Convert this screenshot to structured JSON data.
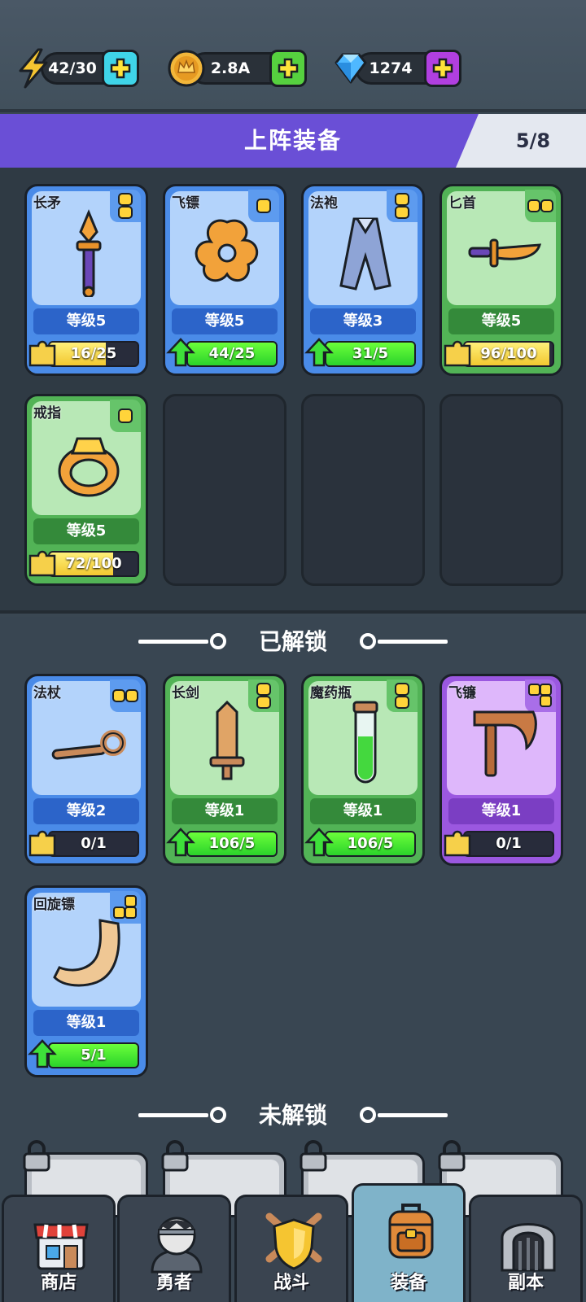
{
  "resources": {
    "energy": {
      "value": "42/30",
      "icon": "lightning-icon"
    },
    "gold": {
      "value": "2.8A",
      "icon": "crown-coin-icon"
    },
    "gems": {
      "value": "1274",
      "icon": "diamond-icon"
    }
  },
  "banner": {
    "title": "上阵装备",
    "count": "5/8"
  },
  "equipped": [
    {
      "name": "长矛",
      "level": "等级5",
      "progress": "16/25",
      "fill": 0.64,
      "color": "blue",
      "ready": false,
      "icon": "spear-icon"
    },
    {
      "name": "飞镖",
      "level": "等级5",
      "progress": "44/25",
      "fill": 1.0,
      "color": "blue",
      "ready": true,
      "icon": "shuriken-icon"
    },
    {
      "name": "法袍",
      "level": "等级3",
      "progress": "31/5",
      "fill": 1.0,
      "color": "blue",
      "ready": true,
      "icon": "robe-icon"
    },
    {
      "name": "匕首",
      "level": "等级5",
      "progress": "96/100",
      "fill": 0.96,
      "color": "green",
      "ready": false,
      "icon": "dagger-icon"
    },
    {
      "name": "戒指",
      "level": "等级5",
      "progress": "72/100",
      "fill": 0.72,
      "color": "green",
      "ready": false,
      "icon": "ring-icon"
    }
  ],
  "unlocked_title": "已解锁",
  "unlocked": [
    {
      "name": "法杖",
      "level": "等级2",
      "progress": "0/1",
      "fill": 0.0,
      "color": "blue",
      "ready": false,
      "icon": "staff-icon"
    },
    {
      "name": "长剑",
      "level": "等级1",
      "progress": "106/5",
      "fill": 1.0,
      "color": "green",
      "ready": true,
      "icon": "sword-icon"
    },
    {
      "name": "魔药瓶",
      "level": "等级1",
      "progress": "106/5",
      "fill": 1.0,
      "color": "green",
      "ready": true,
      "icon": "potion-icon"
    },
    {
      "name": "飞镰",
      "level": "等级1",
      "progress": "0/1",
      "fill": 0.0,
      "color": "purple",
      "ready": false,
      "icon": "sickle-icon"
    },
    {
      "name": "回旋镖",
      "level": "等级1",
      "progress": "5/1",
      "fill": 1.0,
      "color": "blue",
      "ready": true,
      "icon": "boomerang-icon"
    }
  ],
  "locked_title": "未解锁",
  "tabs": [
    {
      "label": "商店",
      "icon": "shop-icon"
    },
    {
      "label": "勇者",
      "icon": "hero-icon"
    },
    {
      "label": "战斗",
      "icon": "battle-icon"
    },
    {
      "label": "装备",
      "icon": "backpack-icon",
      "active": true
    },
    {
      "label": "副本",
      "icon": "dungeon-icon"
    }
  ]
}
